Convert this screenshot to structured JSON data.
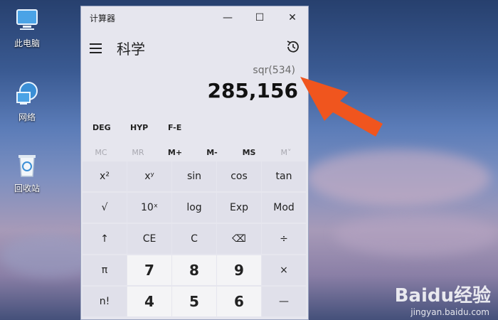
{
  "desktop": {
    "icons": [
      {
        "label": "此电脑",
        "icon": "computer-icon"
      },
      {
        "label": "网络",
        "icon": "network-icon"
      },
      {
        "label": "回收站",
        "icon": "recycle-bin-icon"
      }
    ]
  },
  "window": {
    "title": "计算器",
    "controls": {
      "minimize": "—",
      "maximize": "☐",
      "close": "✕"
    }
  },
  "header": {
    "mode_title": "科学"
  },
  "display": {
    "expression": "sqr(534)",
    "result": "285,156"
  },
  "modes": [
    "DEG",
    "HYP",
    "F-E"
  ],
  "memory": [
    {
      "label": "MC",
      "enabled": false
    },
    {
      "label": "MR",
      "enabled": false
    },
    {
      "label": "M+",
      "enabled": true
    },
    {
      "label": "M-",
      "enabled": true
    },
    {
      "label": "MS",
      "enabled": true
    },
    {
      "label": "M˅",
      "enabled": false
    }
  ],
  "keypad": {
    "row1": [
      "x²",
      "xʸ",
      "sin",
      "cos",
      "tan"
    ],
    "row2": [
      "√",
      "10ˣ",
      "log",
      "Exp",
      "Mod"
    ],
    "row3": [
      "↑",
      "CE",
      "C",
      "⌫",
      "÷"
    ],
    "row4": [
      "π",
      "7",
      "8",
      "9",
      "×"
    ],
    "row5": [
      "n!",
      "4",
      "5",
      "6",
      "—"
    ]
  },
  "watermark": {
    "brand": "Baidu经验",
    "url": "jingyan.baidu.com"
  },
  "colors": {
    "accent_arrow": "#f0551e"
  }
}
